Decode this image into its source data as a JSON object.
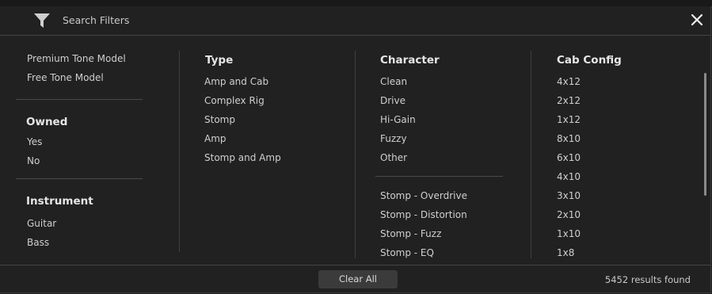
{
  "header": {
    "title": "Search Filters"
  },
  "icons": {
    "filter": "funnel-icon",
    "close": "close-x-icon"
  },
  "left": {
    "tone_models": [
      "Premium Tone Model",
      "Free Tone Model"
    ],
    "owned": {
      "heading": "Owned",
      "items": [
        "Yes",
        "No"
      ]
    },
    "instrument": {
      "heading": "Instrument",
      "items": [
        "Guitar",
        "Bass"
      ]
    }
  },
  "type": {
    "heading": "Type",
    "items": [
      "Amp and Cab",
      "Complex Rig",
      "Stomp",
      "Amp",
      "Stomp and Amp"
    ]
  },
  "character": {
    "heading": "Character",
    "items": [
      "Clean",
      "Drive",
      "Hi-Gain",
      "Fuzzy",
      "Other"
    ],
    "stomp_items": [
      "Stomp - Overdrive",
      "Stomp - Distortion",
      "Stomp - Fuzz",
      "Stomp - EQ"
    ]
  },
  "cab_config": {
    "heading": "Cab Config",
    "items": [
      "4x12",
      "2x12",
      "1x12",
      "8x10",
      "6x10",
      "4x10",
      "3x10",
      "2x10",
      "1x10",
      "1x8"
    ]
  },
  "footer": {
    "clear_all": "Clear All",
    "results": "5452 results found"
  },
  "colors": {
    "background": "#212121",
    "text": "#cfcfcf",
    "heading": "#e6e6e6",
    "separator": "#4a4a4a",
    "button": "#3b3b3b"
  }
}
